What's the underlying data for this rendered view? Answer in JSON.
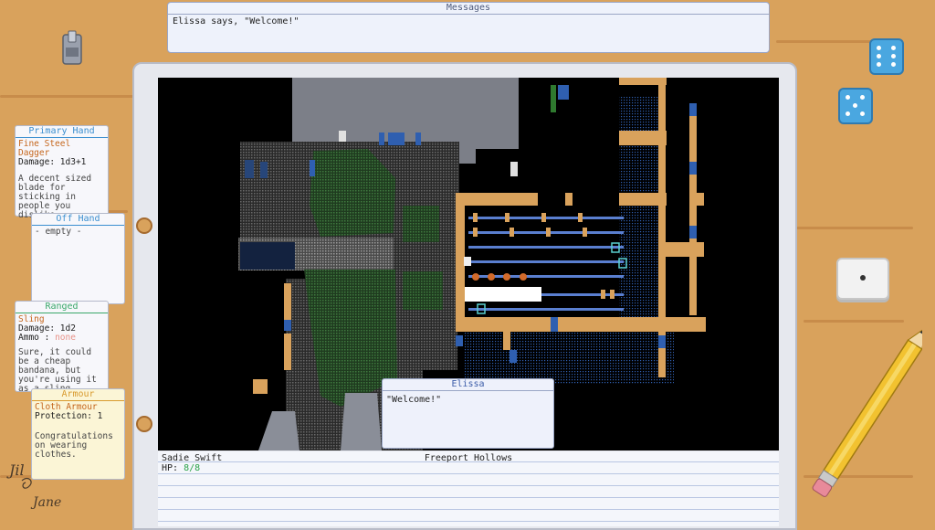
{
  "messages": {
    "title": "Messages",
    "log": [
      "Elissa says, \"Welcome!\""
    ]
  },
  "equipment": {
    "primary": {
      "title": "Primary Hand",
      "item": "Fine Steel Dagger",
      "stat_label": "Damage:",
      "stat_value": "1d3+1",
      "desc": "A decent sized blade for sticking in people you dislike."
    },
    "offhand": {
      "title": "Off Hand",
      "item": "- empty -"
    },
    "ranged": {
      "title": "Ranged",
      "item": "Sling",
      "damage_label": "Damage:",
      "damage_value": "1d2",
      "ammo_label": "Ammo  :",
      "ammo_value": "none",
      "desc": "Sure, it could be a cheap bandana, but you're using it as a sling."
    },
    "armour": {
      "title": "Armour",
      "item": "Cloth Armour",
      "stat_label": "Protection:",
      "stat_value": "1",
      "desc": "Congratulations on wearing clothes."
    }
  },
  "dialog": {
    "speaker": "Elissa",
    "text": "\"Welcome!\""
  },
  "status": {
    "character_name": "Sadie Swift",
    "hp_label": "HP:",
    "hp_value": "8/8",
    "location": "Freeport Hollows"
  },
  "signature": {
    "line1": "Jil",
    "line2": "Jane"
  },
  "colors": {
    "desk": "#d9a25c",
    "primary_accent": "#3b8fd0",
    "offhand_accent": "#3b8fd0",
    "ranged_accent": "#3aa86a",
    "armour_accent": "#d89a2e",
    "hp_green": "#2aa248",
    "item_orange": "#c5661c"
  },
  "icons": [
    "pencil-sharpener-icon",
    "blue-die-icon",
    "white-die-icon",
    "pencil-icon",
    "signature-icon"
  ]
}
